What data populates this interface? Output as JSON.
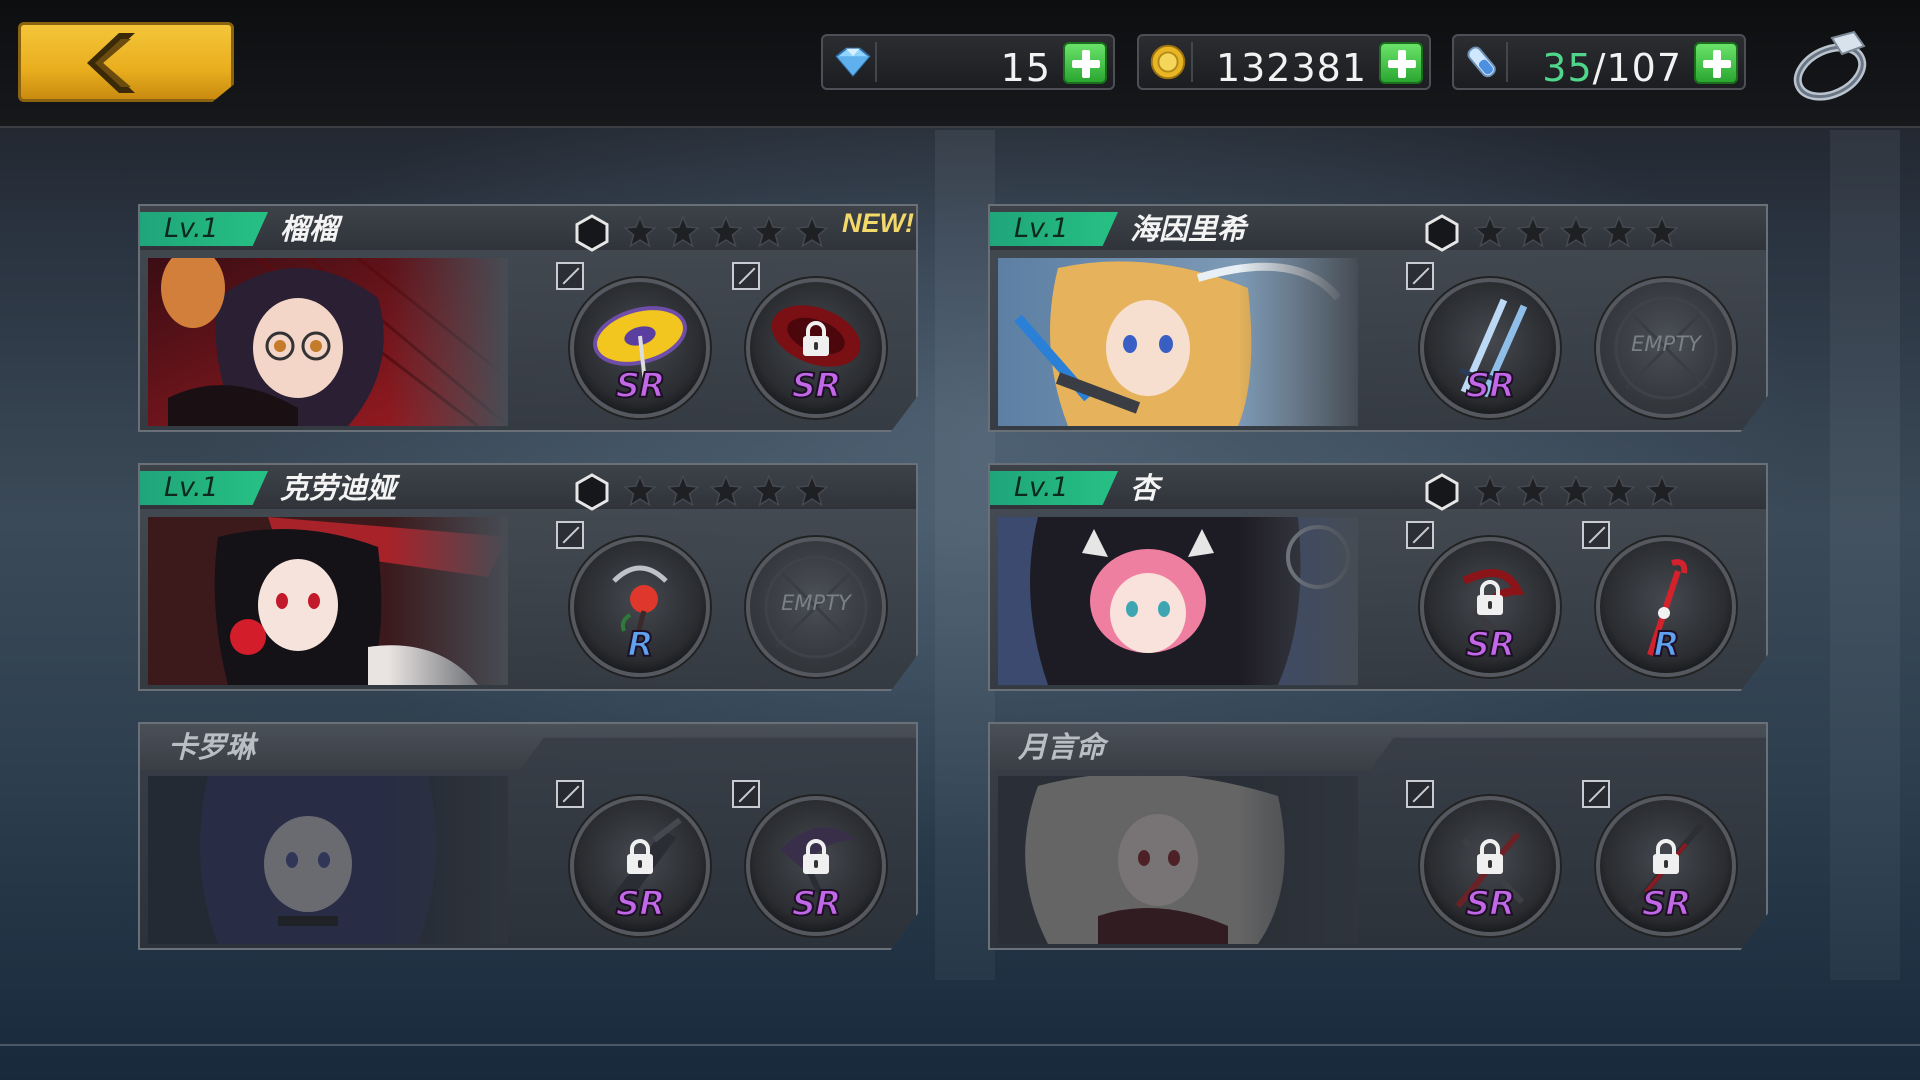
{
  "currencies": [
    {
      "name": "diamond",
      "icon": "gem-icon",
      "value": "15"
    },
    {
      "name": "gold",
      "icon": "gold-coin-icon",
      "value": "132381"
    },
    {
      "name": "stamina",
      "icon": "stamina-vial-icon",
      "current": "35",
      "separator": "/",
      "max": "107"
    }
  ],
  "colors": {
    "accent_green": "#27c184",
    "gold": "#f4c63a",
    "sr": "#c267e8",
    "r": "#5fa2f0"
  },
  "characters": [
    {
      "level": "Lv.1",
      "name": "榴榴",
      "new": "NEW!",
      "stars": 5,
      "slot1": {
        "rarity": "SR",
        "icon": "umbrella-weapon-icon"
      },
      "slot2": {
        "rarity": "SR",
        "locked": true,
        "icon": "red-umbrella-weapon-icon"
      }
    },
    {
      "level": "Lv.1",
      "name": "海因里希",
      "stars": 5,
      "slot1": {
        "rarity": "SR",
        "icon": "twin-swords-weapon-icon"
      },
      "slot2": {
        "empty": "EMPTY"
      }
    },
    {
      "level": "Lv.1",
      "name": "克劳迪娅",
      "stars": 5,
      "slot1": {
        "rarity": "R",
        "icon": "rose-staff-weapon-icon"
      },
      "slot2": {
        "empty": "EMPTY"
      }
    },
    {
      "level": "Lv.1",
      "name": "杏",
      "stars": 5,
      "slot1": {
        "rarity": "SR",
        "locked": true,
        "icon": "claw-weapon-icon"
      },
      "slot2": {
        "rarity": "R",
        "icon": "red-staff-weapon-icon"
      }
    },
    {
      "name": "卡罗琳",
      "locked_character": true,
      "slot1": {
        "rarity": "SR",
        "locked": true,
        "icon": "dark-blade-weapon-icon"
      },
      "slot2": {
        "rarity": "SR",
        "locked": true,
        "icon": "dark-scythe-weapon-icon"
      }
    },
    {
      "name": "月言命",
      "locked_character": true,
      "slot1": {
        "rarity": "SR",
        "locked": true,
        "icon": "scissors-weapon-icon"
      },
      "slot2": {
        "rarity": "SR",
        "locked": true,
        "icon": "spear-weapon-icon"
      }
    }
  ]
}
